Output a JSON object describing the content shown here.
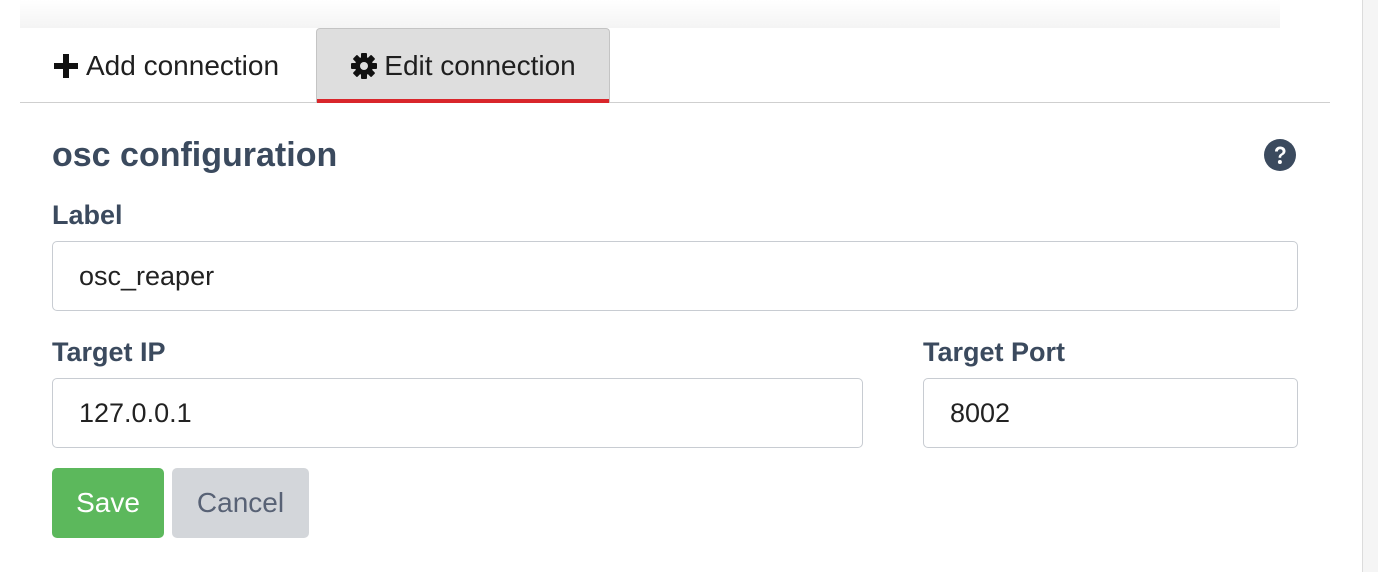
{
  "tabs": {
    "add": {
      "label": "Add connection",
      "icon": "plus-icon"
    },
    "edit": {
      "label": "Edit connection",
      "icon": "gear-icon",
      "active": true
    }
  },
  "form": {
    "title": "osc configuration",
    "help_icon": "question-circle-icon",
    "label": {
      "label": "Label",
      "value": "osc_reaper"
    },
    "target_ip": {
      "label": "Target IP",
      "value": "127.0.0.1"
    },
    "target_port": {
      "label": "Target Port",
      "value": "8002"
    },
    "save_label": "Save",
    "cancel_label": "Cancel"
  },
  "colors": {
    "active_tab_indicator": "#d9262b",
    "save_button": "#5cb85c",
    "cancel_button": "#d3d6da",
    "heading_text": "#3b4a5e"
  }
}
